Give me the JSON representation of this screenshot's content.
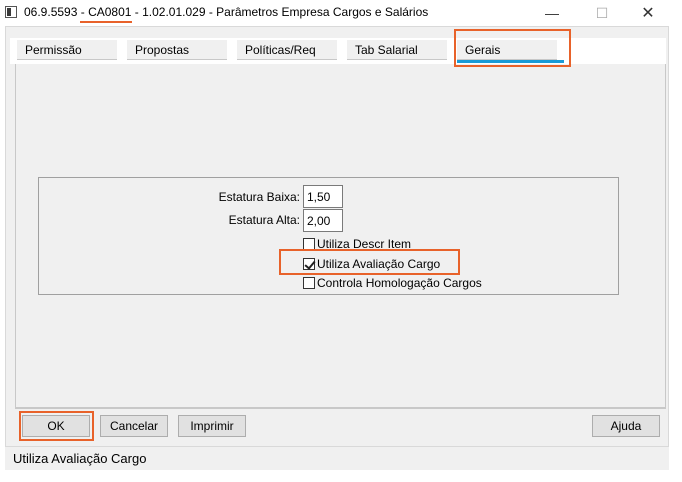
{
  "window": {
    "title_prefix": "06.9.5593 - ",
    "title_code": "CA0801",
    "title_suffix": " - 1.02.01.029 - Parâmetros Empresa Cargos e Salários",
    "minimize": "—",
    "maximize": "☐",
    "close": "✕"
  },
  "tabs": [
    {
      "label": "Permissão"
    },
    {
      "label": "Propostas"
    },
    {
      "label": "Políticas/Req"
    },
    {
      "label": "Tab Salarial"
    },
    {
      "label": "Gerais"
    }
  ],
  "active_tab": "Gerais",
  "form": {
    "estatura_baixa_label": "Estatura Baixa:",
    "estatura_baixa_value": "1,50",
    "estatura_alta_label": "Estatura Alta:",
    "estatura_alta_value": "2,00",
    "checks": [
      {
        "label": "Utiliza Descr Item",
        "checked": false
      },
      {
        "label": "Utiliza Avaliação Cargo",
        "checked": true
      },
      {
        "label": "Controla Homologação Cargos",
        "checked": false
      }
    ]
  },
  "buttons": {
    "ok": "OK",
    "cancel": "Cancelar",
    "print": "Imprimir",
    "help": "Ajuda"
  },
  "status": "Utiliza Avaliação Cargo",
  "colors": {
    "highlight": "#e8622a",
    "active_tab_indicator": "#1a9ad6"
  }
}
